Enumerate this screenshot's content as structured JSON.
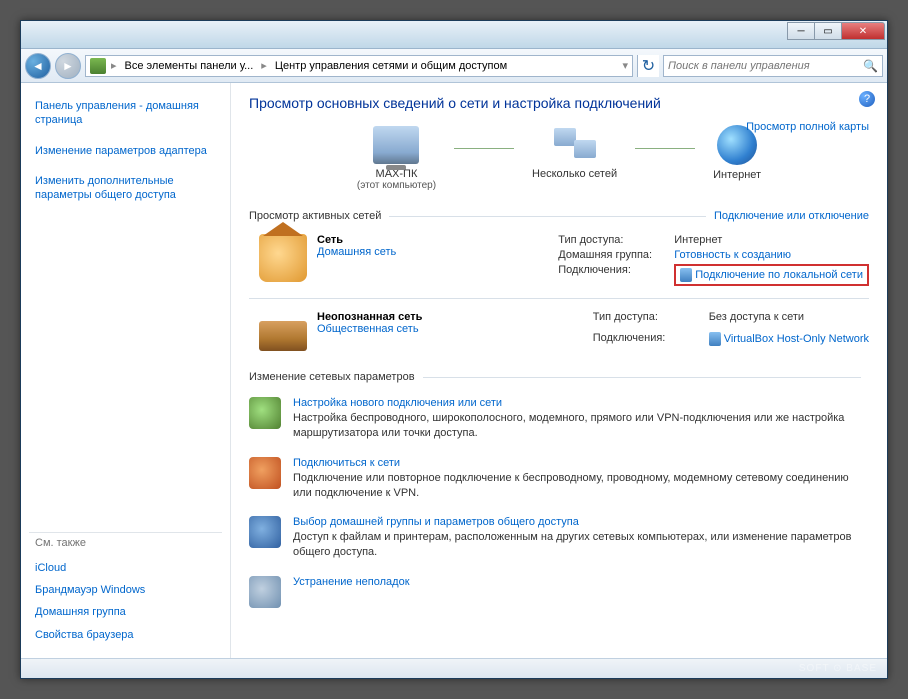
{
  "toolbar": {
    "breadcrumb": {
      "item1": "Все элементы панели у...",
      "item2": "Центр управления сетями и общим доступом"
    },
    "search_placeholder": "Поиск в панели управления"
  },
  "sidebar": {
    "links": {
      "home": "Панель управления - домашняя страница",
      "adapter": "Изменение параметров адаптера",
      "sharing": "Изменить дополнительные параметры общего доступа"
    },
    "seealso_head": "См. также",
    "seealso": {
      "icloud": "iCloud",
      "firewall": "Брандмауэр Windows",
      "homegroup": "Домашняя группа",
      "browser": "Свойства браузера"
    }
  },
  "main": {
    "title": "Просмотр основных сведений о сети и настройка подключений",
    "map_full": "Просмотр полной карты",
    "nodes": {
      "pc_name": "МАХ-ПК",
      "pc_sub": "(этот компьютер)",
      "multi": "Несколько сетей",
      "internet": "Интернет"
    },
    "active_head": "Просмотр активных сетей",
    "connect_link": "Подключение или отключение",
    "net1": {
      "name": "Сеть",
      "type": "Домашняя сеть",
      "access_lbl": "Тип доступа:",
      "access_val": "Интернет",
      "hg_lbl": "Домашняя группа:",
      "hg_val": "Готовность к созданию",
      "conn_lbl": "Подключения:",
      "conn_val": "Подключение по локальной сети"
    },
    "net2": {
      "name": "Неопознанная сеть",
      "type": "Общественная сеть",
      "access_lbl": "Тип доступа:",
      "access_val": "Без доступа к сети",
      "conn_lbl": "Подключения:",
      "conn_val": "VirtualBox Host-Only Network"
    },
    "params_head": "Изменение сетевых параметров",
    "tasks": {
      "t1_link": "Настройка нового подключения или сети",
      "t1_desc": "Настройка беспроводного, широкополосного, модемного, прямого или VPN-подключения или же настройка маршрутизатора или точки доступа.",
      "t2_link": "Подключиться к сети",
      "t2_desc": "Подключение или повторное подключение к беспроводному, проводному, модемному сетевому соединению или подключение к VPN.",
      "t3_link": "Выбор домашней группы и параметров общего доступа",
      "t3_desc": "Доступ к файлам и принтерам, расположенным на других сетевых компьютерах, или изменение параметров общего доступа.",
      "t4_link": "Устранение неполадок"
    }
  },
  "watermark": "SOFT ⊙ BASE"
}
